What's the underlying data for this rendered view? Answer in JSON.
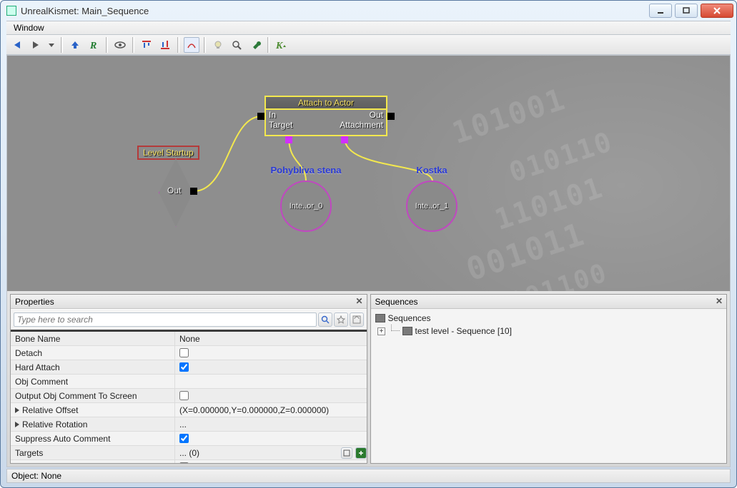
{
  "window": {
    "title": "UnrealKismet: Main_Sequence"
  },
  "menu": {
    "items": [
      "Window"
    ]
  },
  "toolbar": {
    "icons": [
      "back",
      "forward",
      "dropdown",
      "up",
      "root",
      "eye",
      "align-top",
      "align-bottom",
      "toggle",
      "bulb",
      "zoom",
      "wrench",
      "k"
    ]
  },
  "canvas": {
    "event": {
      "title": "Level Startup",
      "out_label": "Out"
    },
    "action": {
      "title": "Attach to Actor",
      "in_label": "In",
      "out_label": "Out",
      "target_label": "Target",
      "attachment_label": "Attachment"
    },
    "var1": {
      "title": "Pohybliva stena",
      "content": "Inte..or_0"
    },
    "var2": {
      "title": "Kostka",
      "content": "Inte..or_1"
    }
  },
  "properties": {
    "panel_title": "Properties",
    "search_placeholder": "Type here to search",
    "rows": [
      {
        "name": "Bone Name",
        "value_text": "None",
        "kind": "text"
      },
      {
        "name": "Detach",
        "kind": "check",
        "checked": false
      },
      {
        "name": "Hard Attach",
        "kind": "check",
        "checked": true
      },
      {
        "name": "Obj Comment",
        "value_text": "",
        "kind": "text"
      },
      {
        "name": "Output Obj Comment To Screen",
        "kind": "check",
        "checked": false
      },
      {
        "name": "Relative Offset",
        "value_text": "(X=0.000000,Y=0.000000,Z=0.000000)",
        "kind": "expand"
      },
      {
        "name": "Relative Rotation",
        "value_text": "...",
        "kind": "expand"
      },
      {
        "name": "Suppress Auto Comment",
        "kind": "check",
        "checked": true
      },
      {
        "name": "Targets",
        "value_text": "... (0)",
        "kind": "targets"
      }
    ]
  },
  "sequences": {
    "panel_title": "Sequences",
    "root": "Sequences",
    "child": "test level - Sequence [10]"
  },
  "status": {
    "text": "Object: None"
  }
}
